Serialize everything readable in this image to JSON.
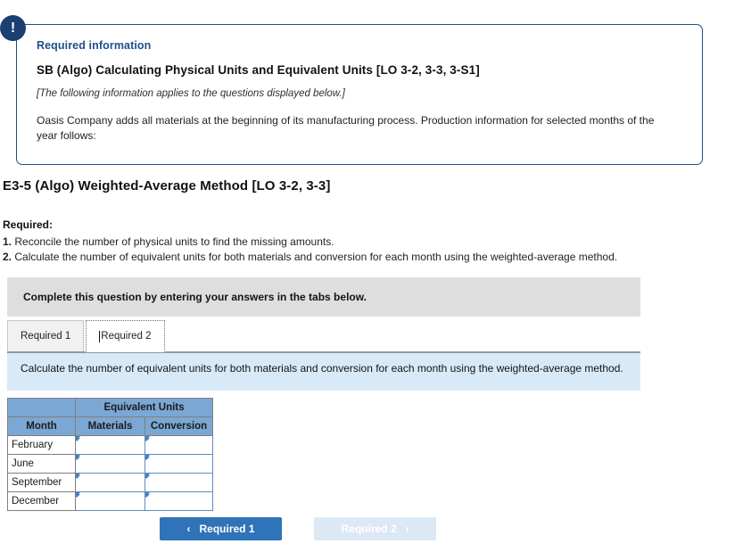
{
  "alert": {
    "icon": "exclamation-icon",
    "glyph": "!"
  },
  "required_info_box": {
    "label": "Required information",
    "title": "SB (Algo) Calculating Physical Units and Equivalent Units [LO 3-2, 3-3, 3-S1]",
    "note": "[The following information applies to the questions displayed below.]",
    "body": "Oasis Company adds all materials at the beginning of its manufacturing process. Production information for selected months of the year follows:",
    "border_color": "#1f4e8c",
    "label_color": "#1f4e8c"
  },
  "exercise": {
    "heading": "E3-5 (Algo) Weighted-Average Method [LO 3-2, 3-3]"
  },
  "required_list": {
    "heading": "Required:",
    "items": [
      {
        "num": "1.",
        "text": " Reconcile the number of physical units to find the missing amounts."
      },
      {
        "num": "2.",
        "text": " Calculate the number of equivalent units for both materials and conversion for each month using the weighted-average method."
      }
    ]
  },
  "complete_bar": {
    "text": "Complete this question by entering your answers in the tabs below.",
    "background": "#dededf"
  },
  "tabs": [
    {
      "label": "Required 1",
      "active": false
    },
    {
      "label": "Required 2",
      "active": true
    }
  ],
  "instruction_bar": {
    "text": "Calculate the number of equivalent units for both materials and conversion for each month using the weighted-average method.",
    "background": "#d8eaf8"
  },
  "answer_table": {
    "group_header": "Equivalent Units",
    "columns": [
      "Month",
      "Materials",
      "Conversion"
    ],
    "header_color": "#7ba7d4",
    "rows": [
      {
        "month": "February",
        "materials": "",
        "conversion": ""
      },
      {
        "month": "June",
        "materials": "",
        "conversion": ""
      },
      {
        "month": "September",
        "materials": "",
        "conversion": ""
      },
      {
        "month": "December",
        "materials": "",
        "conversion": ""
      }
    ]
  },
  "nav_buttons": {
    "prev": {
      "label": "Required 1",
      "chevron": "‹",
      "color": "#2f73b8",
      "enabled": true
    },
    "next": {
      "label": "Required 2",
      "chevron": "›",
      "color": "#dce8f4",
      "enabled": false
    }
  }
}
